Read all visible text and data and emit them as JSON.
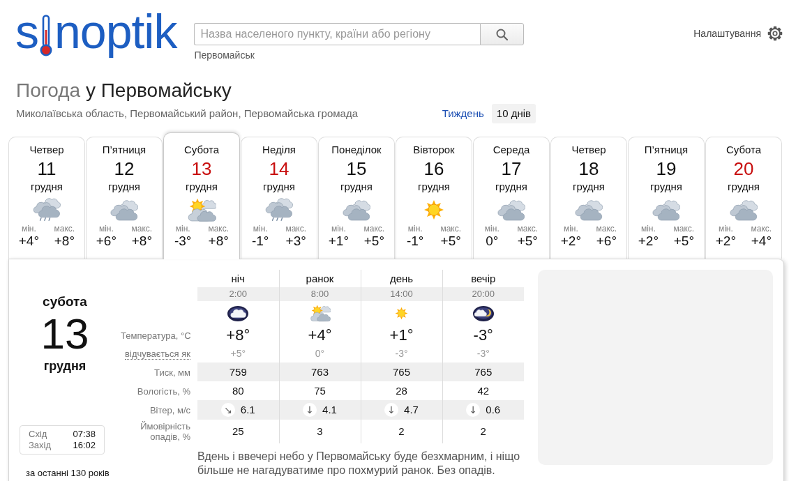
{
  "header": {
    "logo": {
      "text_before_icon": "s",
      "text_after_icon": "noptik"
    },
    "search": {
      "placeholder": "Назва населеного пункту, країни або регіону"
    },
    "recent_city": "Первомайськ",
    "settings": "Налаштування"
  },
  "title": {
    "prefix": "Погода",
    "place": "у Первомайську"
  },
  "location": "Миколаївська область, Первомайський район, Первомайська громада",
  "range_tabs": [
    {
      "label": "Тиждень",
      "selected": false
    },
    {
      "label": "10 днів",
      "selected": true
    }
  ],
  "days": [
    {
      "weekday": "Четвер",
      "date": "11",
      "month": "грудня",
      "weekend": false,
      "selected": false,
      "kind": "rain",
      "min_label": "мін.",
      "min": "+4°",
      "max_label": "макс.",
      "max": "+8°"
    },
    {
      "weekday": "П’ятниця",
      "date": "12",
      "month": "грудня",
      "weekend": false,
      "selected": false,
      "kind": "cloudy",
      "min_label": "мін.",
      "min": "+6°",
      "max_label": "макс.",
      "max": "+8°"
    },
    {
      "weekday": "Субота",
      "date": "13",
      "month": "грудня",
      "weekend": true,
      "selected": true,
      "kind": "partly-cloudy",
      "min_label": "мін.",
      "min": "-3°",
      "max_label": "макс.",
      "max": "+8°"
    },
    {
      "weekday": "Неділя",
      "date": "14",
      "month": "грудня",
      "weekend": true,
      "selected": false,
      "kind": "rain",
      "min_label": "мін.",
      "min": "-1°",
      "max_label": "макс.",
      "max": "+3°"
    },
    {
      "weekday": "Понеділок",
      "date": "15",
      "month": "грудня",
      "weekend": false,
      "selected": false,
      "kind": "cloudy",
      "min_label": "мін.",
      "min": "+1°",
      "max_label": "макс.",
      "max": "+5°"
    },
    {
      "weekday": "Вівторок",
      "date": "16",
      "month": "грудня",
      "weekend": false,
      "selected": false,
      "kind": "sunny",
      "min_label": "мін.",
      "min": "-1°",
      "max_label": "макс.",
      "max": "+5°"
    },
    {
      "weekday": "Середа",
      "date": "17",
      "month": "грудня",
      "weekend": false,
      "selected": false,
      "kind": "cloudy",
      "min_label": "мін.",
      "min": "0°",
      "max_label": "макс.",
      "max": "+5°"
    },
    {
      "weekday": "Четвер",
      "date": "18",
      "month": "грудня",
      "weekend": false,
      "selected": false,
      "kind": "cloudy",
      "min_label": "мін.",
      "min": "+2°",
      "max_label": "макс.",
      "max": "+6°"
    },
    {
      "weekday": "П’ятниця",
      "date": "19",
      "month": "грудня",
      "weekend": false,
      "selected": false,
      "kind": "cloudy",
      "min_label": "мін.",
      "min": "+2°",
      "max_label": "макс.",
      "max": "+5°"
    },
    {
      "weekday": "Субота",
      "date": "20",
      "month": "грудня",
      "weekend": true,
      "selected": false,
      "kind": "cloudy",
      "min_label": "мін.",
      "min": "+2°",
      "max_label": "макс.",
      "max": "+4°"
    }
  ],
  "detail": {
    "weekday": "субота",
    "date": "13",
    "month": "грудня",
    "sun_times": [
      {
        "label": "Схід",
        "time": "07:38"
      },
      {
        "label": "Захід",
        "time": "16:02"
      }
    ],
    "history_note": "за останні 130 років",
    "row_labels": {
      "temperature": "Температура, °C",
      "feels_like": "відчувається як",
      "pressure": "Тиск, мм",
      "humidity": "Вологість, %",
      "wind": "Вітер, м/с",
      "precipitation": "Ймовірність опадів, %"
    },
    "periods": [
      {
        "name": "ніч",
        "time": "2:00",
        "kind": "night-cloudy",
        "temperature": "+8°",
        "feels_like": "+5°",
        "pressure": "759",
        "humidity": "80",
        "wind_arrow": "↘",
        "wind": "6.1",
        "precipitation": "25"
      },
      {
        "name": "ранок",
        "time": "8:00",
        "kind": "partly-cloudy",
        "temperature": "+4°",
        "feels_like": "0°",
        "pressure": "763",
        "humidity": "75",
        "wind_arrow": "↓",
        "wind": "4.1",
        "precipitation": "3"
      },
      {
        "name": "день",
        "time": "14:00",
        "kind": "sunny",
        "temperature": "+1°",
        "feels_like": "-3°",
        "pressure": "765",
        "humidity": "28",
        "wind_arrow": "↓",
        "wind": "4.7",
        "precipitation": "2"
      },
      {
        "name": "вечір",
        "time": "20:00",
        "kind": "night-partly-cloudy",
        "temperature": "-3°",
        "feels_like": "-3°",
        "pressure": "765",
        "humidity": "42",
        "wind_arrow": "↓",
        "wind": "0.6",
        "precipitation": "2"
      }
    ],
    "description": "Вдень і ввечері небо у Первомайську буде безхмарним, і ніщо більше не нагадуватиме про похмурий ранок. Без опадів."
  }
}
